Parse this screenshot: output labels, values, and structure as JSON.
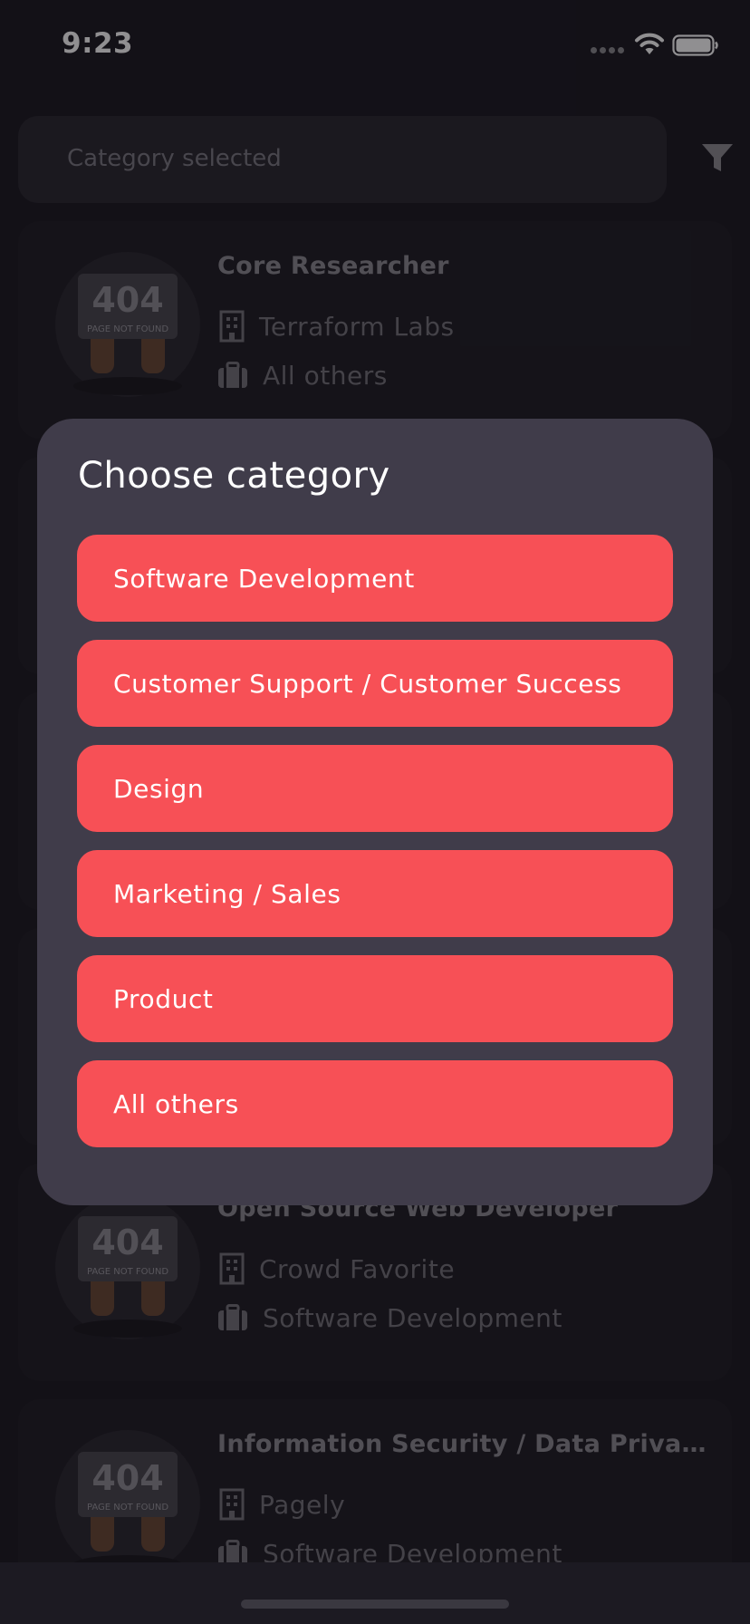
{
  "status_bar": {
    "time": "9:23",
    "icons": [
      "signal-dots-icon",
      "wifi-icon",
      "battery-icon"
    ]
  },
  "search": {
    "placeholder": "Category selected",
    "filter_icon": "filter-funnel-icon"
  },
  "jobs": [
    {
      "title": "Core Researcher",
      "company": "Terraform Labs",
      "category": "All others",
      "image": "404 PAGE NOT FOUND"
    },
    {
      "title": "",
      "company": "",
      "category": "",
      "image": ""
    },
    {
      "title": "",
      "company": "",
      "category": "",
      "image": ""
    },
    {
      "title": "",
      "company": "",
      "category": "",
      "image": ""
    },
    {
      "title": "Open Source Web Developer",
      "company": "Crowd Favorite",
      "category": "Software Development",
      "image": "404 PAGE NOT FOUND"
    },
    {
      "title": "Information Security / Data Privac...",
      "company": "Pagely",
      "category": "Software Development",
      "image": "404 PAGE NOT FOUND"
    }
  ],
  "modal": {
    "title": "Choose category",
    "options": [
      {
        "label": "Software Development"
      },
      {
        "label": "Customer Support / Customer Success"
      },
      {
        "label": "Design"
      },
      {
        "label": "Marketing / Sales"
      },
      {
        "label": "Product"
      },
      {
        "label": "All others"
      }
    ]
  },
  "colors": {
    "background": "#1c1a22",
    "card": "#201e25",
    "modal": "#403c4a",
    "accent": "#f75056"
  }
}
